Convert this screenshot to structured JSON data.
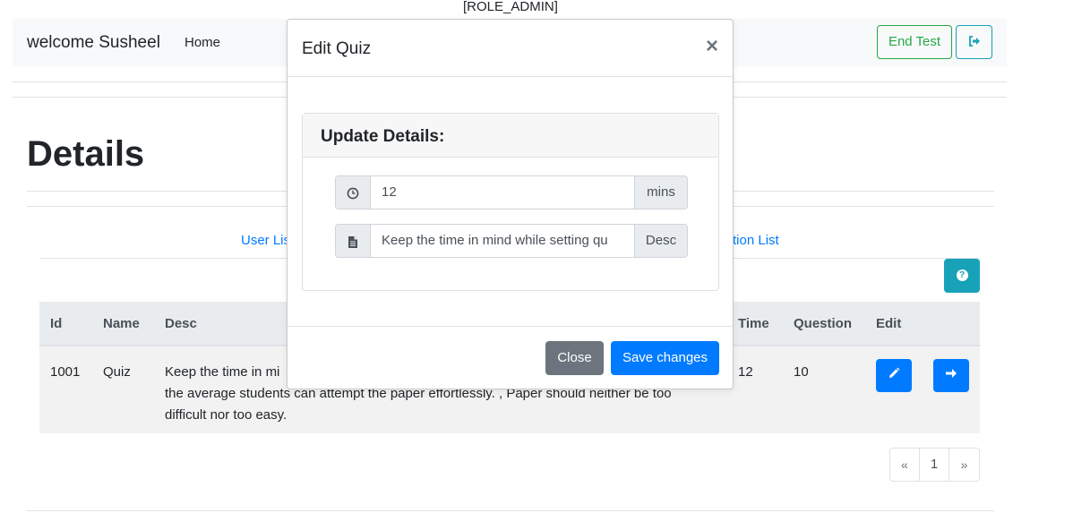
{
  "role": "[ROLE_ADMIN]",
  "navbar": {
    "brand": "welcome Susheel",
    "home_label": "Home",
    "end_test_label": "End Test",
    "logout_icon": "sign-out-icon"
  },
  "page": {
    "title": "Details",
    "links": {
      "left_partial": "User Lis",
      "right_partial": "tion List"
    }
  },
  "table": {
    "headers": [
      "Id",
      "Name",
      "Desc",
      "Time",
      "Question",
      "Edit"
    ],
    "rows": [
      {
        "id": "1001",
        "name": "Quiz",
        "desc_line1": "Keep the time in mi",
        "desc_line2": "the average students can attempt the paper effortlessly. , Paper should neither be too",
        "desc_line3": "difficult nor too easy.",
        "time": "12",
        "question": "10"
      }
    ]
  },
  "pagination": {
    "prev": "«",
    "current": "1",
    "next": "»"
  },
  "modal": {
    "title": "Edit Quiz",
    "close_symbol": "×",
    "card_title": "Update Details:",
    "time_field": {
      "value": "12",
      "suffix": "mins",
      "icon": "clock-icon"
    },
    "desc_field": {
      "value": "Keep the time in mind while setting qu",
      "suffix": "Desc",
      "icon": "file-text-icon"
    },
    "close_button": "Close",
    "save_button": "Save changes"
  },
  "colors": {
    "primary": "#007bff",
    "success": "#28a745",
    "info": "#17a2b8",
    "secondary": "#6c757d"
  }
}
